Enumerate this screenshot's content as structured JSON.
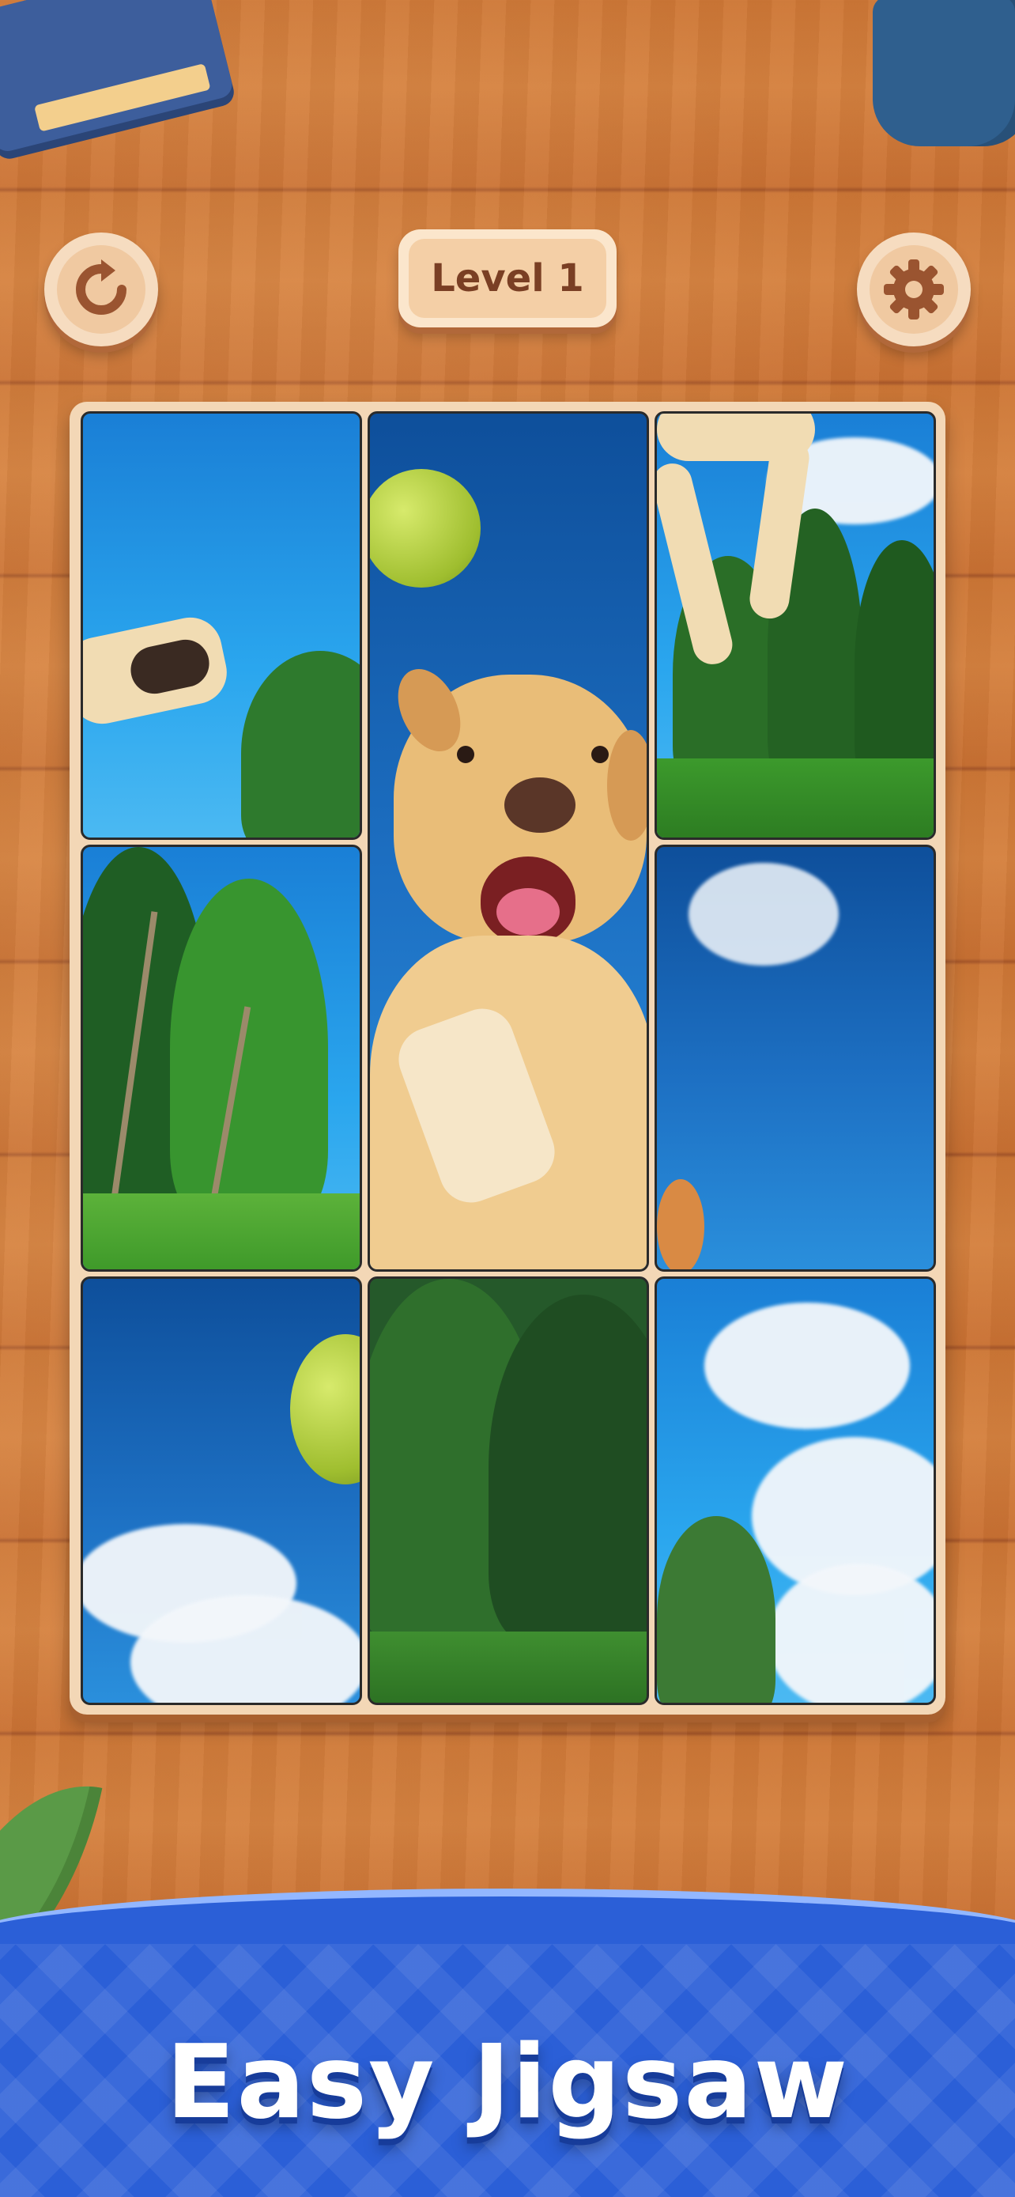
{
  "header": {
    "level_label": "Level 1",
    "restart_icon": "restart-icon",
    "settings_icon": "gear-icon"
  },
  "board": {
    "columns": 3,
    "rows": 3,
    "tiles": [
      {
        "id": "r1c1",
        "content": "sky-with-dog-paw"
      },
      {
        "id": "r1-2c2",
        "content": "dog-face-with-ball",
        "merged": true
      },
      {
        "id": "r1c3",
        "content": "dog-legs-and-trees"
      },
      {
        "id": "r2c1",
        "content": "trees-and-grass"
      },
      {
        "id": "r2c3",
        "content": "sky-with-cloud"
      },
      {
        "id": "r3c1",
        "content": "sky-with-ball-and-clouds"
      },
      {
        "id": "r3c2",
        "content": "dark-trees-and-grass"
      },
      {
        "id": "r3c3",
        "content": "clouds-and-tree"
      }
    ]
  },
  "banner": {
    "title": "Easy Jigsaw"
  },
  "colors": {
    "wood": "#cd7736",
    "board_frame": "#f3d7b6",
    "banner_blue": "#2b5fd7",
    "button_text": "#7a3f24"
  }
}
